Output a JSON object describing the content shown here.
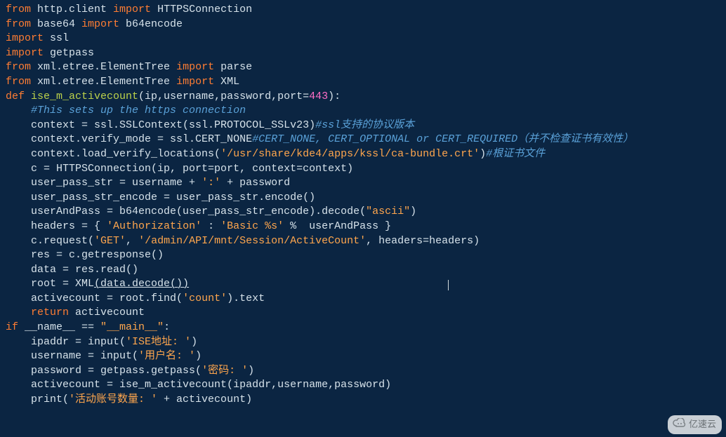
{
  "code": {
    "lines": [
      {
        "indent": 0,
        "tokens": [
          [
            "kw",
            "from"
          ],
          [
            "pln",
            " http.client "
          ],
          [
            "kw",
            "import"
          ],
          [
            "pln",
            " HTTPSConnection"
          ]
        ]
      },
      {
        "indent": 0,
        "tokens": [
          [
            "kw",
            "from"
          ],
          [
            "pln",
            " base64 "
          ],
          [
            "kw",
            "import"
          ],
          [
            "pln",
            " b64encode"
          ]
        ]
      },
      {
        "indent": 0,
        "tokens": [
          [
            "kw",
            "import"
          ],
          [
            "pln",
            " ssl"
          ]
        ]
      },
      {
        "indent": 0,
        "tokens": [
          [
            "kw",
            "import"
          ],
          [
            "pln",
            " getpass"
          ]
        ]
      },
      {
        "indent": 0,
        "tokens": [
          [
            "kw",
            "from"
          ],
          [
            "pln",
            " xml.etree.ElementTree "
          ],
          [
            "kw",
            "import"
          ],
          [
            "pln",
            " parse"
          ]
        ]
      },
      {
        "indent": 0,
        "tokens": [
          [
            "kw",
            "from"
          ],
          [
            "pln",
            " xml.etree.ElementTree "
          ],
          [
            "kw",
            "import"
          ],
          [
            "pln",
            " XML"
          ]
        ]
      },
      {
        "indent": 0,
        "tokens": [
          [
            "kw",
            "def "
          ],
          [
            "fn",
            "ise_m_activecount"
          ],
          [
            "pln",
            "(ip,username,password,port="
          ],
          [
            "num",
            "443"
          ],
          [
            "pln",
            "):"
          ]
        ]
      },
      {
        "indent": 0,
        "tokens": [
          [
            "pln",
            ""
          ]
        ]
      },
      {
        "indent": 1,
        "tokens": [
          [
            "cm",
            "#This sets up the https connection"
          ]
        ]
      },
      {
        "indent": 1,
        "tokens": [
          [
            "pln",
            "context = ssl.SSLContext(ssl.PROTOCOL_SSLv23)"
          ],
          [
            "cm",
            "#ssl支持的协议版本"
          ]
        ]
      },
      {
        "indent": 1,
        "tokens": [
          [
            "pln",
            "context.verify_mode = ssl.CERT_NONE"
          ],
          [
            "cm",
            "#CERT_NONE, CERT_OPTIONAL or CERT_REQUIRED（并不检查证书有效性）"
          ]
        ]
      },
      {
        "indent": 1,
        "tokens": [
          [
            "pln",
            "context.load_verify_locations("
          ],
          [
            "str",
            "'/usr/share/kde4/apps/kssl/ca-bundle.crt'"
          ],
          [
            "pln",
            ")"
          ],
          [
            "cm",
            "#根证书文件"
          ]
        ]
      },
      {
        "indent": 1,
        "tokens": [
          [
            "pln",
            "c = HTTPSConnection(ip, port=port, context=context)"
          ]
        ]
      },
      {
        "indent": 1,
        "tokens": [
          [
            "pln",
            "user_pass_str = username + "
          ],
          [
            "str",
            "':'"
          ],
          [
            "pln",
            " + password"
          ]
        ]
      },
      {
        "indent": 1,
        "tokens": [
          [
            "pln",
            "user_pass_str_encode = user_pass_str.encode()"
          ]
        ]
      },
      {
        "indent": 1,
        "tokens": [
          [
            "pln",
            "userAndPass = b64encode(user_pass_str_encode).decode("
          ],
          [
            "str",
            "\"ascii\""
          ],
          [
            "pln",
            ")"
          ]
        ]
      },
      {
        "indent": 1,
        "tokens": [
          [
            "pln",
            "headers = { "
          ],
          [
            "str",
            "'Authorization'"
          ],
          [
            "pln",
            " : "
          ],
          [
            "str",
            "'Basic %s'"
          ],
          [
            "pln",
            " %  userAndPass }"
          ]
        ]
      },
      {
        "indent": 1,
        "tokens": [
          [
            "pln",
            "c.request("
          ],
          [
            "str",
            "'GET'"
          ],
          [
            "pln",
            ", "
          ],
          [
            "str",
            "'/admin/API/mnt/Session/ActiveCount'"
          ],
          [
            "pln",
            ", headers=headers)"
          ]
        ]
      },
      {
        "indent": 1,
        "tokens": [
          [
            "pln",
            "res = c.getresponse()"
          ]
        ]
      },
      {
        "indent": 1,
        "tokens": [
          [
            "pln",
            "data = res.read()"
          ]
        ]
      },
      {
        "indent": 1,
        "tokens": [
          [
            "pln",
            "root = XML"
          ],
          [
            "plnu",
            "(data.decode())"
          ]
        ]
      },
      {
        "indent": 1,
        "tokens": [
          [
            "pln",
            "activecount = root.find("
          ],
          [
            "str",
            "'count'"
          ],
          [
            "pln",
            ").text"
          ]
        ]
      },
      {
        "indent": 1,
        "tokens": [
          [
            "kw",
            "return"
          ],
          [
            "pln",
            " activecount"
          ]
        ]
      },
      {
        "indent": 0,
        "tokens": [
          [
            "pln",
            ""
          ]
        ]
      },
      {
        "indent": 0,
        "tokens": [
          [
            "kw",
            "if"
          ],
          [
            "pln",
            " __name__ == "
          ],
          [
            "str",
            "\"__main__\""
          ],
          [
            "pln",
            ":"
          ]
        ]
      },
      {
        "indent": 1,
        "tokens": [
          [
            "pln",
            "ipaddr = input("
          ],
          [
            "str",
            "'ISE地址: '"
          ],
          [
            "pln",
            ")"
          ]
        ]
      },
      {
        "indent": 1,
        "tokens": [
          [
            "pln",
            "username = input("
          ],
          [
            "str",
            "'用户名: '"
          ],
          [
            "pln",
            ")"
          ]
        ]
      },
      {
        "indent": 1,
        "tokens": [
          [
            "pln",
            "password = getpass.getpass("
          ],
          [
            "str",
            "'密码: '"
          ],
          [
            "pln",
            ")"
          ]
        ]
      },
      {
        "indent": 1,
        "tokens": [
          [
            "pln",
            "activecount = ise_m_activecount(ipaddr,username,password)"
          ]
        ]
      },
      {
        "indent": 1,
        "tokens": [
          [
            "pln",
            "print("
          ],
          [
            "str",
            "'活动账号数量: '"
          ],
          [
            "pln",
            " + activecount)"
          ]
        ]
      }
    ]
  },
  "indent_unit": "    ",
  "watermark": {
    "text": "亿速云"
  }
}
